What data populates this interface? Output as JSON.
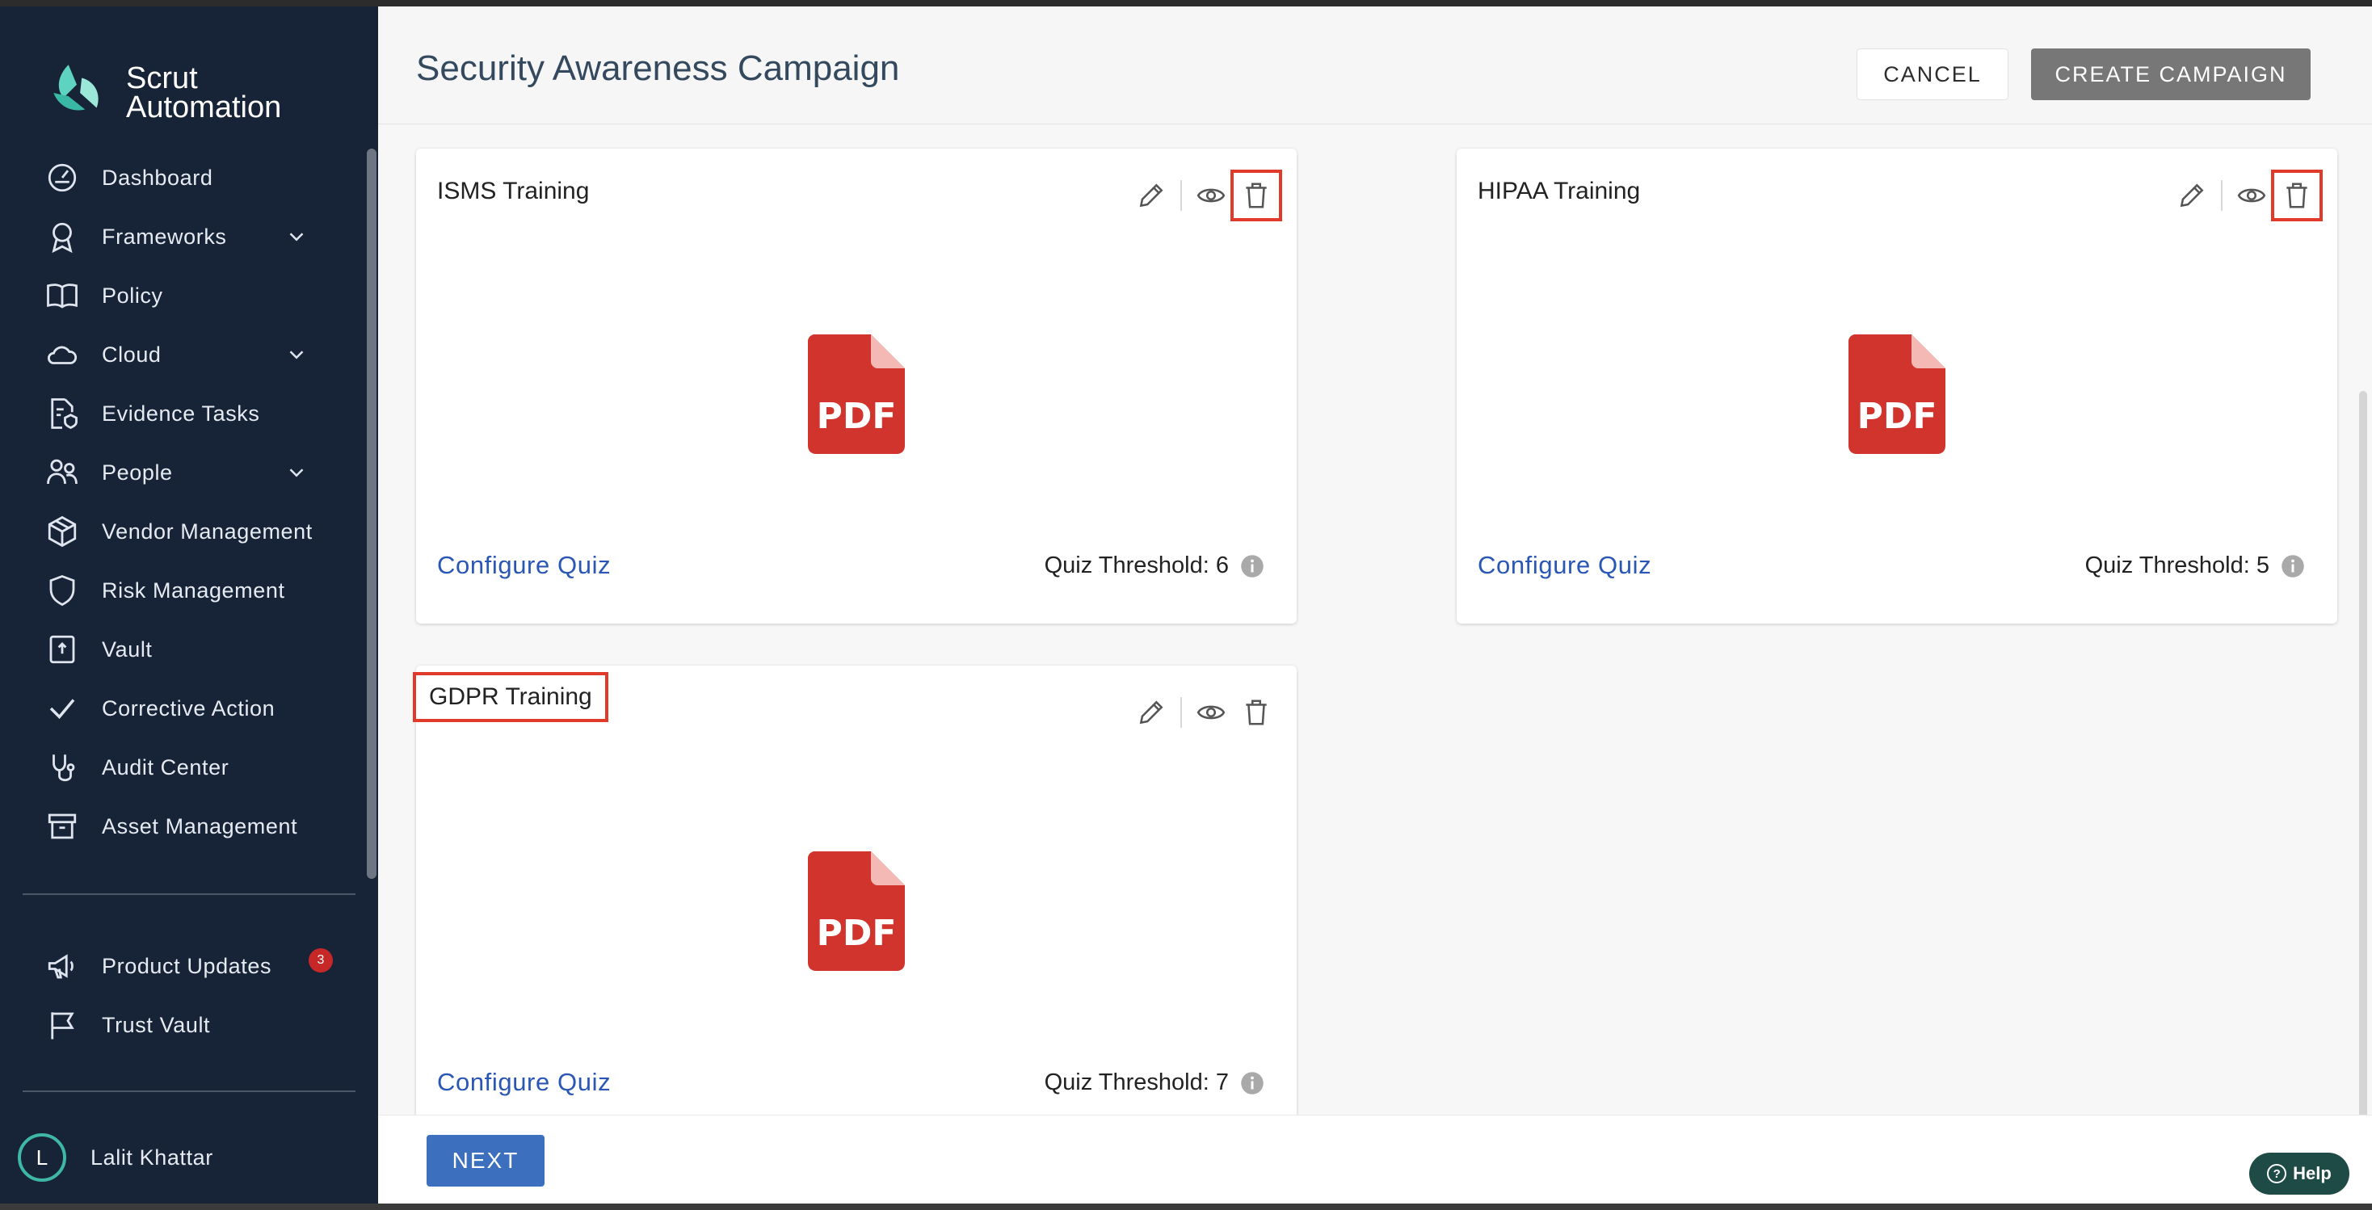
{
  "app": {
    "logo_line1": "Scrut",
    "logo_line2": "Automation"
  },
  "sidebar": {
    "items": [
      {
        "label": "Dashboard",
        "icon": "dashboard-icon",
        "expandable": false
      },
      {
        "label": "Frameworks",
        "icon": "award-icon",
        "expandable": true
      },
      {
        "label": "Policy",
        "icon": "book-icon",
        "expandable": false
      },
      {
        "label": "Cloud",
        "icon": "cloud-icon",
        "expandable": true
      },
      {
        "label": "Evidence Tasks",
        "icon": "file-shield-icon",
        "expandable": false
      },
      {
        "label": "People",
        "icon": "people-icon",
        "expandable": true
      },
      {
        "label": "Vendor Management",
        "icon": "box-icon",
        "expandable": false
      },
      {
        "label": "Risk Management",
        "icon": "shield-icon",
        "expandable": false
      },
      {
        "label": "Vault",
        "icon": "vault-icon",
        "expandable": false
      },
      {
        "label": "Corrective Action",
        "icon": "check-icon",
        "expandable": false
      },
      {
        "label": "Audit Center",
        "icon": "stethoscope-icon",
        "expandable": false
      },
      {
        "label": "Asset Management",
        "icon": "archive-icon",
        "expandable": false
      }
    ],
    "secondary": [
      {
        "label": "Product Updates",
        "icon": "megaphone-icon",
        "badge": "3"
      },
      {
        "label": "Trust Vault",
        "icon": "flag-icon"
      }
    ],
    "user": {
      "initial": "L",
      "name": "Lalit Khattar"
    }
  },
  "header": {
    "title": "Security Awareness Campaign",
    "cancel_label": "CANCEL",
    "create_label": "CREATE CAMPAIGN"
  },
  "cards": [
    {
      "title": "ISMS Training",
      "file_label": "PDF",
      "configure_label": "Configure Quiz",
      "threshold_label": "Quiz Threshold: 6"
    },
    {
      "title": "HIPAA Training",
      "file_label": "PDF",
      "configure_label": "Configure Quiz",
      "threshold_label": "Quiz Threshold: 5"
    },
    {
      "title": "GDPR Training",
      "file_label": "PDF",
      "configure_label": "Configure Quiz",
      "threshold_label": "Quiz Threshold: 7"
    }
  ],
  "footer": {
    "next_label": "NEXT"
  },
  "help": {
    "label": "Help"
  },
  "colors": {
    "sidebar_bg": "#172336",
    "accent_blue": "#2a57b5",
    "pdf_red": "#d0342c",
    "highlight": "#e03b2a"
  }
}
